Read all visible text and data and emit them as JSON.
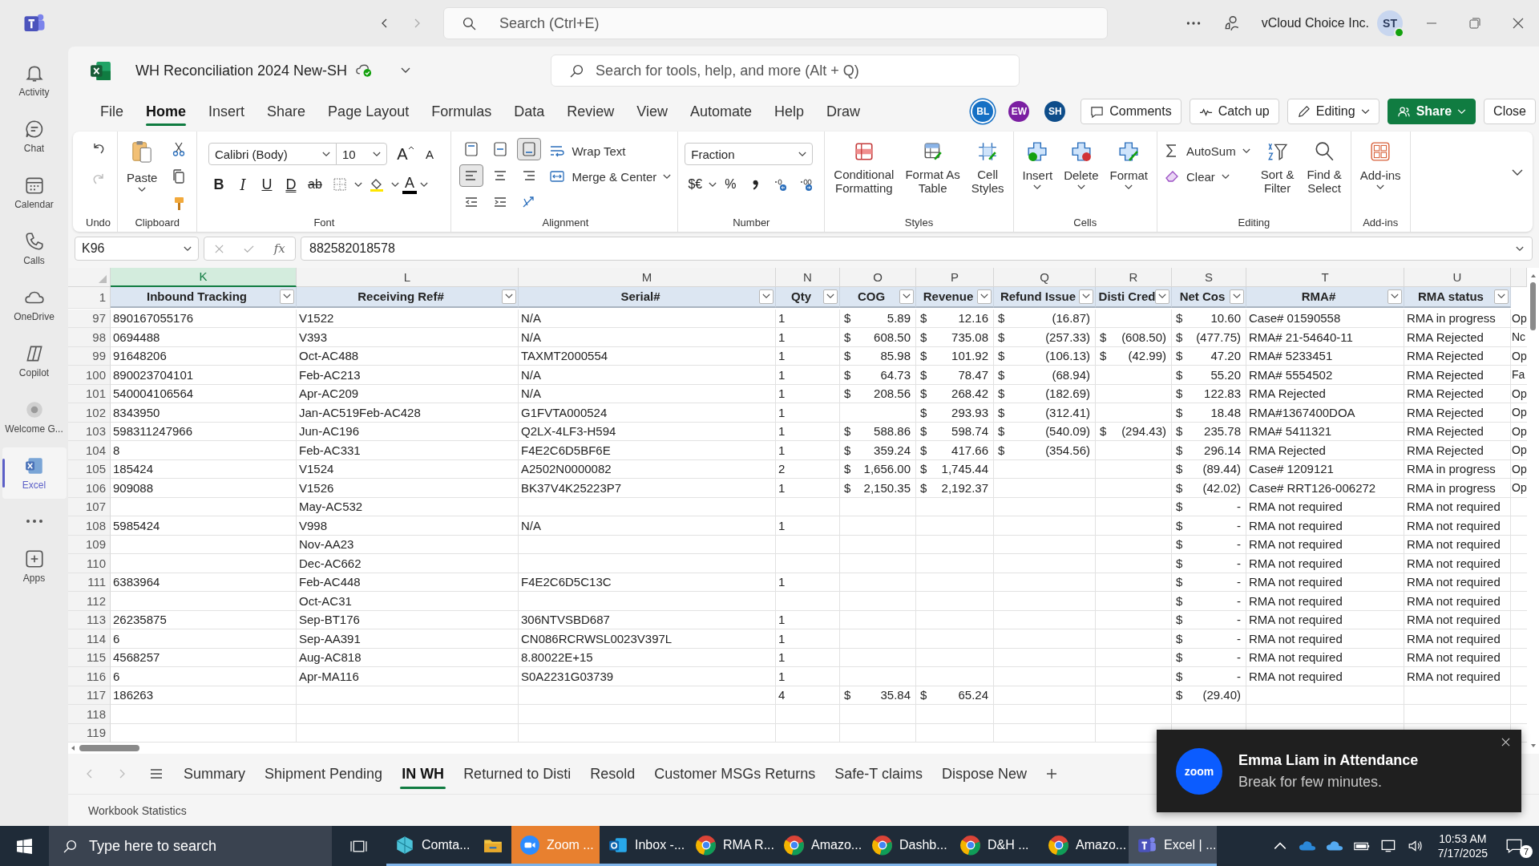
{
  "teams_bar": {
    "search": {
      "placeholder": "Search (Ctrl+E)"
    },
    "org": "vCloud Choice Inc.",
    "avatar": "ST"
  },
  "rail": [
    {
      "label": "Activity",
      "kind": "bell",
      "selected": false
    },
    {
      "label": "Chat",
      "kind": "chat",
      "selected": false
    },
    {
      "label": "Calendar",
      "kind": "calendar",
      "selected": false
    },
    {
      "label": "Calls",
      "kind": "phone",
      "selected": false
    },
    {
      "label": "OneDrive",
      "kind": "cloud",
      "selected": false
    },
    {
      "label": "Copilot",
      "kind": "copilot",
      "selected": false
    },
    {
      "label": "Welcome G...",
      "kind": "welcome",
      "selected": false
    },
    {
      "label": "Excel",
      "kind": "excel",
      "selected": true
    }
  ],
  "rail_apps": {
    "label": "Apps"
  },
  "app": {
    "title": "WH Reconciliation 2024 New-SH",
    "search": {
      "placeholder": "Search for tools, help, and more (Alt + Q)"
    }
  },
  "menu_tabs": [
    {
      "label": "File",
      "selected": false
    },
    {
      "label": "Home",
      "selected": true
    },
    {
      "label": "Insert",
      "selected": false
    },
    {
      "label": "Share",
      "selected": false
    },
    {
      "label": "Page Layout",
      "selected": false
    },
    {
      "label": "Formulas",
      "selected": false
    },
    {
      "label": "Data",
      "selected": false
    },
    {
      "label": "Review",
      "selected": false
    },
    {
      "label": "View",
      "selected": false
    },
    {
      "label": "Automate",
      "selected": false
    },
    {
      "label": "Help",
      "selected": false
    },
    {
      "label": "Draw",
      "selected": false
    }
  ],
  "collaborators": [
    {
      "initials": "BL",
      "color": "#1670c4"
    },
    {
      "initials": "EW",
      "color": "#7b1fa2"
    },
    {
      "initials": "SH",
      "color": "#0e4d8a"
    }
  ],
  "actions": [
    {
      "label": "Comments",
      "kind": "comments"
    },
    {
      "label": "Catch up",
      "kind": "catchup"
    },
    {
      "label": "Editing",
      "kind": "editing"
    },
    {
      "label": "Share",
      "kind": "share"
    },
    {
      "label": "Close",
      "kind": "close"
    }
  ],
  "ribbon": {
    "undo": {
      "group": "Undo"
    },
    "clipboard": {
      "paste": "Paste",
      "group": "Clipboard"
    },
    "font": {
      "family": "Calibri (Body)",
      "size": "10",
      "grow": "A",
      "shrink": "A",
      "styles": [
        {
          "glyph": "B",
          "kind": "bold"
        },
        {
          "glyph": "I",
          "kind": "italic"
        },
        {
          "glyph": "U",
          "kind": "underline"
        },
        {
          "glyph": "D",
          "kind": "double"
        },
        {
          "glyph": "ab",
          "kind": "strike"
        }
      ],
      "color_glyph": "A",
      "group": "Font"
    },
    "alignment": {
      "vertical": [
        {
          "kind": "top",
          "selected": false
        },
        {
          "kind": "middle",
          "selected": false
        },
        {
          "kind": "bottom",
          "selected": true
        }
      ],
      "horizontal": [
        {
          "kind": "left",
          "selected": true
        },
        {
          "kind": "center",
          "selected": false
        },
        {
          "kind": "right",
          "selected": false
        }
      ],
      "wrap": "Wrap Text",
      "merge": "Merge & Center",
      "group": "Alignment"
    },
    "number": {
      "format": "Fraction",
      "currency": "$€",
      "percent": "%",
      "group": "Number"
    },
    "styles": {
      "buttons": [
        {
          "kind": "conditional",
          "lines": [
            "Conditional",
            "Formatting"
          ]
        },
        {
          "kind": "table",
          "lines": [
            "Format As",
            "Table"
          ]
        },
        {
          "kind": "cellstyles",
          "lines": [
            "Cell",
            "Styles"
          ]
        }
      ],
      "group": "Styles"
    },
    "cells": {
      "buttons": [
        {
          "kind": "insert",
          "label": "Insert"
        },
        {
          "kind": "delete",
          "label": "Delete"
        },
        {
          "kind": "format",
          "label": "Format"
        }
      ],
      "group": "Cells"
    },
    "editing": {
      "autosum": "AutoSum",
      "clear": "Clear",
      "sort": [
        "Sort &",
        "Filter"
      ],
      "find": [
        "Find &",
        "Select"
      ],
      "group": "Editing"
    },
    "addins": {
      "button": "Add-ins",
      "group": "Add-ins"
    }
  },
  "formula_bar": {
    "name_box": "K96",
    "fx": "fx",
    "formula": "882582018578"
  },
  "grid": {
    "columns": [
      {
        "letter": "K",
        "title": "Inbound Tracking",
        "kind": "text",
        "selected": true
      },
      {
        "letter": "L",
        "title": "Receiving Ref#",
        "kind": "text",
        "selected": false
      },
      {
        "letter": "M",
        "title": "Serial#",
        "kind": "text",
        "selected": false
      },
      {
        "letter": "N",
        "title": "Qty",
        "kind": "text",
        "selected": false
      },
      {
        "letter": "O",
        "title": "COG",
        "kind": "currency",
        "selected": false
      },
      {
        "letter": "P",
        "title": "Revenue",
        "kind": "currency",
        "selected": false
      },
      {
        "letter": "Q",
        "title": "Refund Issue",
        "kind": "currency",
        "selected": false
      },
      {
        "letter": "R",
        "title": "Disti Cred",
        "kind": "currency",
        "selected": false
      },
      {
        "letter": "S",
        "title": "Net Cos",
        "kind": "currency",
        "selected": false
      },
      {
        "letter": "T",
        "title": "RMA#",
        "kind": "text",
        "selected": false
      },
      {
        "letter": "U",
        "title": "RMA status",
        "kind": "text",
        "selected": false
      },
      {
        "kind": "text",
        "selected": false
      }
    ],
    "header_row": "1",
    "rows": [
      {
        "n": "97",
        "cells": [
          "890167055176",
          "V1522",
          "N/A",
          "1",
          [
            "$",
            "5.89"
          ],
          [
            "$",
            "12.16"
          ],
          [
            "$",
            "(16.87)"
          ],
          null,
          [
            "$",
            "10.60"
          ],
          "Case# 01590558",
          "RMA in progress",
          "Op"
        ]
      },
      {
        "n": "98",
        "cells": [
          "0694488",
          "V393",
          "N/A",
          "1",
          [
            "$",
            "608.50"
          ],
          [
            "$",
            "735.08"
          ],
          [
            "$",
            "(257.33)"
          ],
          [
            "$",
            "(608.50)"
          ],
          [
            "$",
            "(477.75)"
          ],
          "RMA# 21-54640-11",
          "RMA Rejected",
          "Nc"
        ]
      },
      {
        "n": "99",
        "cells": [
          "91648206",
          "Oct-AC488",
          "TAXMT2000554",
          "1",
          [
            "$",
            "85.98"
          ],
          [
            "$",
            "101.92"
          ],
          [
            "$",
            "(106.13)"
          ],
          [
            "$",
            "(42.99)"
          ],
          [
            "$",
            "47.20"
          ],
          "RMA# 5233451",
          "RMA Rejected",
          "Op"
        ]
      },
      {
        "n": "100",
        "cells": [
          "890023704101",
          "Feb-AC213",
          "N/A",
          "1",
          [
            "$",
            "64.73"
          ],
          [
            "$",
            "78.47"
          ],
          [
            "$",
            "(68.94)"
          ],
          null,
          [
            "$",
            "55.20"
          ],
          "RMA# 5554502",
          "RMA Rejected",
          "Fa"
        ]
      },
      {
        "n": "101",
        "cells": [
          "540004106564",
          "Apr-AC209",
          "N/A",
          "1",
          [
            "$",
            "208.56"
          ],
          [
            "$",
            "268.42"
          ],
          [
            "$",
            "(182.69)"
          ],
          null,
          [
            "$",
            "122.83"
          ],
          "RMA Rejected",
          "RMA Rejected",
          "Op"
        ]
      },
      {
        "n": "102",
        "cells": [
          "8343950",
          "Jan-AC519Feb-AC428",
          "G1FVTA000524",
          "1",
          null,
          [
            "$",
            "293.93"
          ],
          [
            "$",
            "(312.41)"
          ],
          null,
          [
            "$",
            "18.48"
          ],
          "RMA#1367400DOA",
          "RMA Rejected",
          "Op"
        ]
      },
      {
        "n": "103",
        "cells": [
          "598311247966",
          "Jun-AC196",
          "Q2LX-4LF3-H594",
          "1",
          [
            "$",
            "588.86"
          ],
          [
            "$",
            "598.74"
          ],
          [
            "$",
            "(540.09)"
          ],
          [
            "$",
            "(294.43)"
          ],
          [
            "$",
            "235.78"
          ],
          "RMA# 5411321",
          "RMA Rejected",
          "Op"
        ]
      },
      {
        "n": "104",
        "cells": [
          "8",
          "Feb-AC331",
          "F4E2C6D5BF6E",
          "1",
          [
            "$",
            "359.24"
          ],
          [
            "$",
            "417.66"
          ],
          [
            "$",
            "(354.56)"
          ],
          null,
          [
            "$",
            "296.14"
          ],
          "RMA Rejected",
          "RMA Rejected",
          "Op"
        ]
      },
      {
        "n": "105",
        "cells": [
          "185424",
          "V1524",
          "A2502N0000082",
          "2",
          [
            "$",
            "1,656.00"
          ],
          [
            "$",
            "1,745.44"
          ],
          null,
          null,
          [
            "$",
            "(89.44)"
          ],
          "Case# 1209121",
          "RMA in progress",
          "Op"
        ]
      },
      {
        "n": "106",
        "cells": [
          "909088",
          "V1526",
          "BK37V4K25223P7",
          "1",
          [
            "$",
            "2,150.35"
          ],
          [
            "$",
            "2,192.37"
          ],
          null,
          null,
          [
            "$",
            "(42.02)"
          ],
          "Case# RRT126-006272",
          "RMA in progress",
          "Op"
        ]
      },
      {
        "n": "107",
        "cells": [
          null,
          "May-AC532",
          null,
          null,
          null,
          null,
          null,
          null,
          [
            "$",
            "-"
          ],
          "RMA not required",
          "RMA not required",
          null
        ]
      },
      {
        "n": "108",
        "cells": [
          "5985424",
          "V998",
          "N/A",
          "1",
          null,
          null,
          null,
          null,
          [
            "$",
            "-"
          ],
          "RMA not required",
          "RMA not required",
          null
        ]
      },
      {
        "n": "109",
        "cells": [
          null,
          "Nov-AA23",
          null,
          null,
          null,
          null,
          null,
          null,
          [
            "$",
            "-"
          ],
          "RMA not required",
          "RMA not required",
          null
        ]
      },
      {
        "n": "110",
        "cells": [
          null,
          "Dec-AC662",
          null,
          null,
          null,
          null,
          null,
          null,
          [
            "$",
            "-"
          ],
          "RMA not required",
          "RMA not required",
          null
        ]
      },
      {
        "n": "111",
        "cells": [
          "6383964",
          "Feb-AC448",
          "F4E2C6D5C13C",
          "1",
          null,
          null,
          null,
          null,
          [
            "$",
            "-"
          ],
          "RMA not required",
          "RMA not required",
          null
        ]
      },
      {
        "n": "112",
        "cells": [
          null,
          "Oct-AC31",
          null,
          null,
          null,
          null,
          null,
          null,
          [
            "$",
            "-"
          ],
          "RMA not required",
          "RMA not required",
          null
        ]
      },
      {
        "n": "113",
        "cells": [
          "26235875",
          "Sep-BT176",
          "306NTVSBD687",
          "1",
          null,
          null,
          null,
          null,
          [
            "$",
            "-"
          ],
          "RMA not required",
          "RMA not required",
          null
        ]
      },
      {
        "n": "114",
        "cells": [
          "6",
          "Sep-AA391",
          "CN086RCRWSL0023V397L",
          "1",
          null,
          null,
          null,
          null,
          [
            "$",
            "-"
          ],
          "RMA not required",
          "RMA not required",
          null
        ]
      },
      {
        "n": "115",
        "cells": [
          "4568257",
          "Aug-AC818",
          "8.80022E+15",
          "1",
          null,
          null,
          null,
          null,
          [
            "$",
            "-"
          ],
          "RMA not required",
          "RMA not required",
          null
        ]
      },
      {
        "n": "116",
        "cells": [
          "6",
          "Apr-MA116",
          "S0A2231G03739",
          "1",
          null,
          null,
          null,
          null,
          [
            "$",
            "-"
          ],
          "RMA not required",
          "RMA not required",
          null
        ]
      },
      {
        "n": "117",
        "cells": [
          "186263",
          null,
          null,
          "4",
          [
            "$",
            "35.84"
          ],
          [
            "$",
            "65.24"
          ],
          null,
          null,
          [
            "$",
            "(29.40)"
          ],
          null,
          null,
          null
        ]
      },
      {
        "n": "118",
        "cells": [
          null,
          null,
          null,
          null,
          null,
          null,
          null,
          null,
          null,
          null,
          null,
          null
        ]
      },
      {
        "n": "119",
        "cells": [
          null,
          null,
          null,
          null,
          null,
          null,
          null,
          null,
          null,
          null,
          null,
          null
        ]
      }
    ]
  },
  "sheet_tabs": [
    {
      "label": "Summary",
      "selected": false
    },
    {
      "label": "Shipment Pending",
      "selected": false
    },
    {
      "label": "IN WH",
      "selected": true
    },
    {
      "label": "Returned to Disti",
      "selected": false
    },
    {
      "label": "Resold",
      "selected": false
    },
    {
      "label": "Customer MSGs Returns",
      "selected": false
    },
    {
      "label": "Safe-T claims",
      "selected": false
    },
    {
      "label": "Dispose New",
      "selected": false
    }
  ],
  "status_bar": {
    "text": "Workbook Statistics"
  },
  "toast": {
    "logo": "zoom",
    "title": "Emma Liam in Attendance",
    "body": "Break for few minutes."
  },
  "taskbar": {
    "search": {
      "placeholder": "Type here to search"
    },
    "apps": [
      {
        "kind": "gem",
        "label": "Comta...",
        "selected": false,
        "attention": false
      },
      {
        "kind": "folder",
        "selected": false,
        "attention": false
      },
      {
        "kind": "zoom",
        "label": "Zoom ...",
        "selected": false,
        "attention": true
      },
      {
        "kind": "mail",
        "label": "Inbox -...",
        "selected": false,
        "attention": false
      },
      {
        "kind": "browser",
        "label": "RMA R...",
        "selected": false,
        "attention": false
      },
      {
        "kind": "browser",
        "label": "Amazo...",
        "selected": false,
        "attention": false
      },
      {
        "kind": "browser",
        "label": "Dashb...",
        "selected": false,
        "attention": false
      },
      {
        "kind": "browser",
        "label": "D&H ...",
        "selected": false,
        "attention": false
      },
      {
        "kind": "browser",
        "label": "Amazo...",
        "selected": false,
        "attention": false
      },
      {
        "kind": "teams",
        "label": "Excel | ...",
        "selected": true,
        "attention": false
      }
    ],
    "time": "10:53 AM",
    "date": "7/17/2025",
    "notifications": "7"
  }
}
